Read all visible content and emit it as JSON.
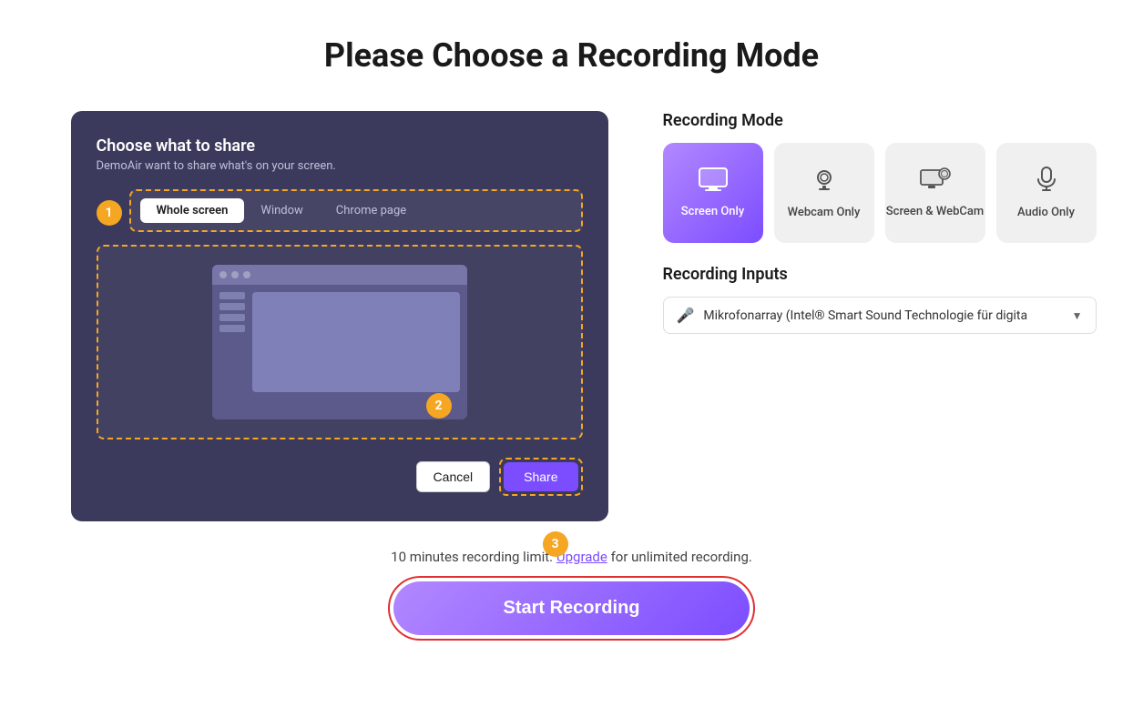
{
  "page": {
    "title": "Please Choose a Recording Mode"
  },
  "dialog": {
    "title": "Choose what to share",
    "subtitle": "DemoAir want to share what's on your screen.",
    "tabs": [
      "Whole screen",
      "Window",
      "Chrome page"
    ],
    "active_tab": "Whole screen",
    "step1": "1",
    "step2": "2",
    "step3": "3",
    "cancel_label": "Cancel",
    "share_label": "Share"
  },
  "recording_mode": {
    "label": "Recording Mode",
    "modes": [
      {
        "id": "screen-only",
        "label": "Screen Only",
        "icon": "screen"
      },
      {
        "id": "webcam-only",
        "label": "Webcam Only",
        "icon": "webcam"
      },
      {
        "id": "screen-webcam",
        "label": "Screen & WebCam",
        "icon": "screen-webcam"
      },
      {
        "id": "audio-only",
        "label": "Audio Only",
        "icon": "audio"
      }
    ],
    "active": "screen-only"
  },
  "recording_inputs": {
    "label": "Recording Inputs",
    "microphone": "Mikrofonarray (Intel® Smart Sound Technologie für digita"
  },
  "bottom": {
    "limit_text": "10 minutes recording limit.",
    "upgrade_label": "Upgrade",
    "upgrade_suffix": "for unlimited recording.",
    "start_label": "Start Recording"
  }
}
